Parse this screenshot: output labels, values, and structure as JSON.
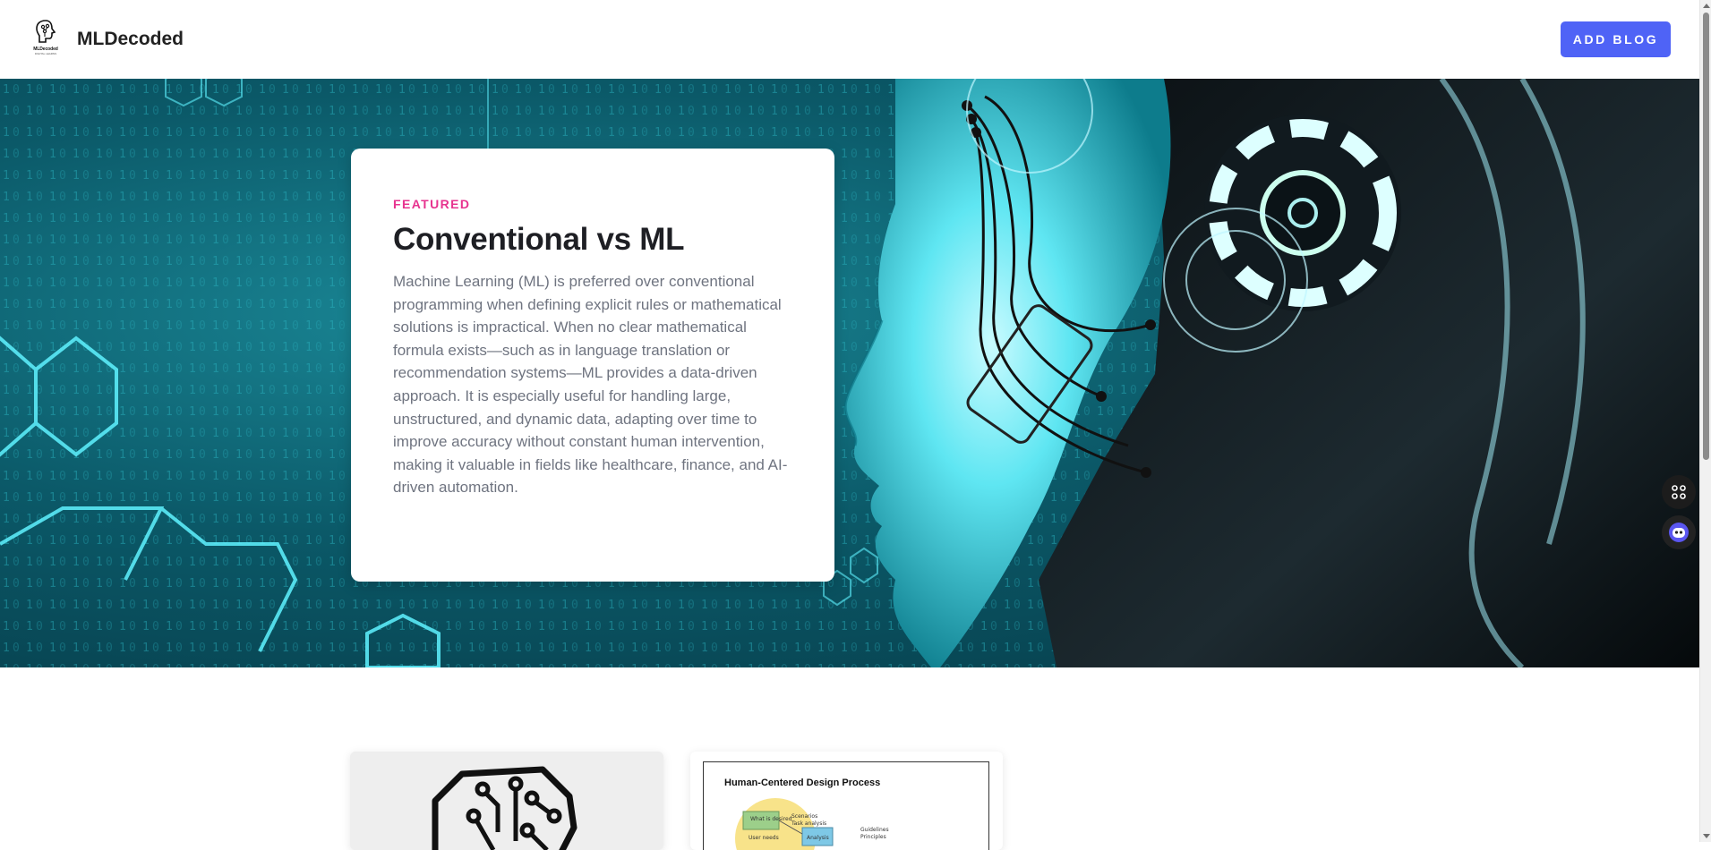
{
  "header": {
    "logo_text": "MLDecoded",
    "logo_subtext": "DIGITAL LEARNS",
    "brand_name": "MLDecoded",
    "add_blog_label": "ADD BLOG"
  },
  "featured": {
    "label": "FEATURED",
    "title": "Conventional vs ML",
    "body": "Machine Learning (ML) is preferred over conventional programming when defining explicit rules or mathematical solutions is impractical. When no clear mathematical formula exists—such as in language translation or recommendation systems—ML provides a data-driven approach. It is especially useful for handling large, unstructured, and dynamic data, adapting over time to improve accuracy without constant human intervention, making it valuable in fields like healthcare, finance, and AI-driven automation."
  },
  "posts": [
    {
      "image_icon": "circuit-brain-icon"
    },
    {
      "image_icon": "design-process-diagram",
      "diagram_title": "Human-Centered Design Process",
      "diagram_labels": [
        "What is desired",
        "Scenarios",
        "Task analysis",
        "Guidelines",
        "Principles",
        "Analysis",
        "User needs"
      ]
    }
  ],
  "widgets": {
    "apps_icon": "apps-grid-icon",
    "bot_icon": "assistant-bot-icon"
  },
  "colors": {
    "accent": "#4f63f6",
    "featured_label": "#e7338f",
    "hero_teal": "#0b5968"
  }
}
